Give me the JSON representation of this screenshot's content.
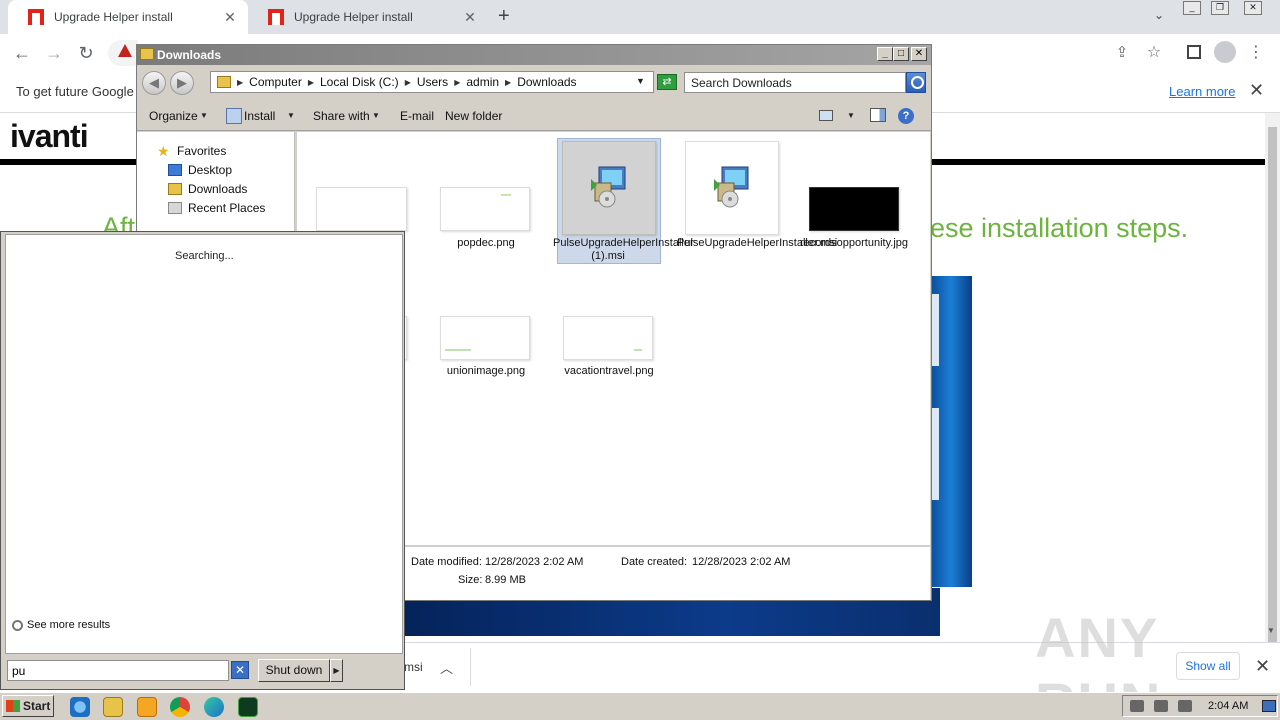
{
  "browser": {
    "tabs": [
      {
        "title": "Upgrade Helper install",
        "active": true
      },
      {
        "title": "Upgrade Helper install",
        "active": false
      }
    ],
    "new_tab_symbol": "+",
    "tab_close_symbol": "✕",
    "infobar": {
      "text": "To get future Google",
      "learn_more": "Learn more",
      "close_symbol": "✕"
    }
  },
  "page": {
    "logo": "ivanti",
    "heading_left": "Aft",
    "heading_right": "ese installation steps."
  },
  "explorer": {
    "title": "Downloads",
    "window_buttons": {
      "minimize": "_",
      "maximize": "□",
      "close": "✕"
    },
    "breadcrumb": [
      "Computer",
      "Local Disk (C:)",
      "Users",
      "admin",
      "Downloads"
    ],
    "search_placeholder": "Search Downloads",
    "toolbar": {
      "organize": "Organize",
      "install": "Install",
      "share_with": "Share with",
      "email": "E-mail",
      "new_folder": "New folder"
    },
    "nav": {
      "favorites": "Favorites",
      "desktop": "Desktop",
      "downloads": "Downloads",
      "recent": "Recent Places"
    },
    "files": [
      {
        "name": "popdec.png",
        "type": "image"
      },
      {
        "name": "PulseUpgradeHelperInstaller (1).msi",
        "type": "msi",
        "selected": true
      },
      {
        "name": "PulseUpgradeHelperInstaller.msi",
        "type": "msi"
      },
      {
        "name": "recordsopportunity.jpg",
        "type": "dark-image"
      },
      {
        "name": "unionimage.png",
        "type": "image"
      },
      {
        "name": "vacationtravel.png",
        "type": "image"
      }
    ],
    "details": {
      "modified_label": "Date modified:",
      "modified_value": "12/28/2023 2:02 AM",
      "created_label": "Date created:",
      "created_value": "12/28/2023 2:02 AM",
      "size_label": "Size:",
      "size_value": "8.99 MB"
    }
  },
  "start_menu": {
    "status": "Searching...",
    "see_more": "See more results",
    "search_value": "pu",
    "shutdown": "Shut down"
  },
  "download_bar": {
    "item_fragment": "msi",
    "show_all": "Show all",
    "close_symbol": "✕"
  },
  "watermark": "ANY RUN",
  "taskbar": {
    "start": "Start",
    "clock": "2:04 AM"
  }
}
